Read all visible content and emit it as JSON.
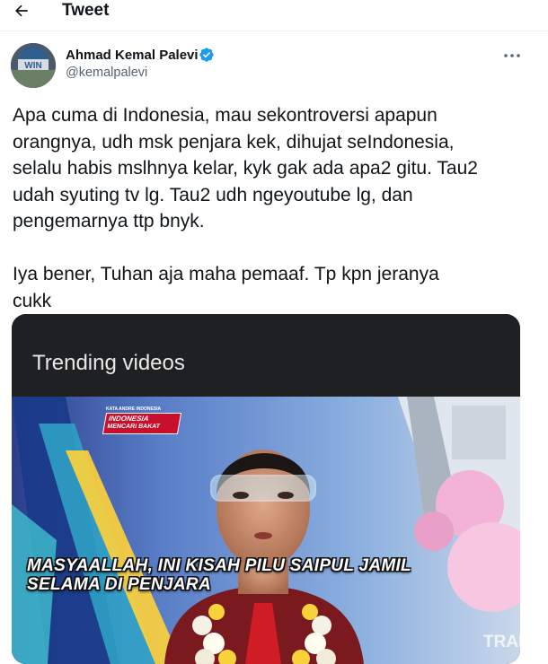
{
  "header": {
    "title": "Tweet",
    "back_icon": "arrow-left-icon"
  },
  "author": {
    "name": "Ahmad Kemal Palevi",
    "handle": "@kemalpalevi",
    "verified_icon": "verified-badge-icon",
    "avatar_text": "WIN"
  },
  "tweet": {
    "text": "Apa cuma di Indonesia, mau sekontroversi apapun\norangnya, udh msk penjara kek, dihujat seIndonesia,\nselalu habis mslhnya kelar, kyk gak ada apa2 gitu. Tau2\nudah syuting tv lg. Tau2 udh ngeyoutube lg, dan\npengemarnya ttp bnyk.\n\nIya bener, Tuhan aja maha pemaaf. Tp kpn jeranya\ncukk"
  },
  "media": {
    "title": "Trending videos",
    "show_logo_top": "KATA ANDRE INDONESIA",
    "show_logo_main": "INDONESIA",
    "show_logo_sub": "MENCARI BAKAT",
    "caption_line1": "MASYAALLAH, INI KISAH PILU SAIPUL JAMIL",
    "caption_line2": "SELAMA DI PENJARA",
    "watermark": "TRAN"
  },
  "colors": {
    "accent": "#1d9bf0",
    "text": "#0f1419",
    "secondary": "#536471"
  }
}
